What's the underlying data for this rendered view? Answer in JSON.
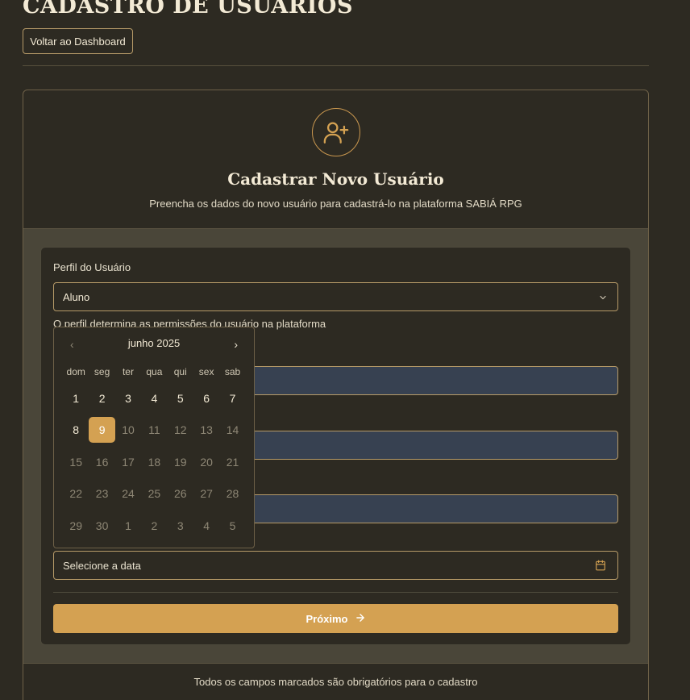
{
  "page": {
    "title": "CADASTRO DE USUÁRIOS",
    "back_button": "Voltar ao Dashboard"
  },
  "card": {
    "icon": "user-plus-icon",
    "title": "Cadastrar Novo Usuário",
    "subtitle": "Preencha os dados do novo usuário para cadastrá-lo na plataforma SABIÁ RPG"
  },
  "form": {
    "profile_label": "Perfil do Usuário",
    "profile_value": "Aluno",
    "profile_hint": "O perfil determina as permissões do usuário na plataforma",
    "date_placeholder": "Selecione a data",
    "next_button": "Próximo",
    "footer": "Todos os campos marcados são obrigatórios para o cadastro"
  },
  "calendar": {
    "month_label": "junho 2025",
    "weekdays": [
      "dom",
      "seg",
      "ter",
      "qua",
      "qui",
      "sex",
      "sab"
    ],
    "weeks": [
      [
        {
          "d": "1"
        },
        {
          "d": "2"
        },
        {
          "d": "3"
        },
        {
          "d": "4"
        },
        {
          "d": "5"
        },
        {
          "d": "6"
        },
        {
          "d": "7"
        }
      ],
      [
        {
          "d": "8"
        },
        {
          "d": "9",
          "selected": true
        },
        {
          "d": "10",
          "muted": true
        },
        {
          "d": "11",
          "muted": true
        },
        {
          "d": "12",
          "muted": true
        },
        {
          "d": "13",
          "muted": true
        },
        {
          "d": "14",
          "muted": true
        }
      ],
      [
        {
          "d": "15",
          "muted": true
        },
        {
          "d": "16",
          "muted": true
        },
        {
          "d": "17",
          "muted": true
        },
        {
          "d": "18",
          "muted": true
        },
        {
          "d": "19",
          "muted": true
        },
        {
          "d": "20",
          "muted": true
        },
        {
          "d": "21",
          "muted": true
        }
      ],
      [
        {
          "d": "22",
          "muted": true
        },
        {
          "d": "23",
          "muted": true
        },
        {
          "d": "24",
          "muted": true
        },
        {
          "d": "25",
          "muted": true
        },
        {
          "d": "26",
          "muted": true
        },
        {
          "d": "27",
          "muted": true
        },
        {
          "d": "28",
          "muted": true
        }
      ],
      [
        {
          "d": "29",
          "muted": true
        },
        {
          "d": "30",
          "muted": true
        },
        {
          "d": "1",
          "muted": true
        },
        {
          "d": "2",
          "muted": true
        },
        {
          "d": "3",
          "muted": true
        },
        {
          "d": "4",
          "muted": true
        },
        {
          "d": "5",
          "muted": true
        }
      ]
    ]
  },
  "colors": {
    "background": "#2d2a22",
    "accent": "#d4a152",
    "border": "#b69a68",
    "field_fill": "#374151"
  }
}
